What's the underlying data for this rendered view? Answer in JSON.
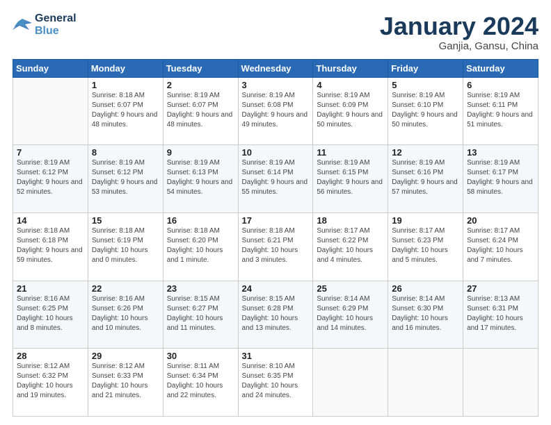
{
  "header": {
    "logo_line1": "General",
    "logo_line2": "Blue",
    "title": "January 2024",
    "subtitle": "Ganjia, Gansu, China"
  },
  "weekdays": [
    "Sunday",
    "Monday",
    "Tuesday",
    "Wednesday",
    "Thursday",
    "Friday",
    "Saturday"
  ],
  "weeks": [
    [
      {
        "day": "",
        "sunrise": "",
        "sunset": "",
        "daylight": ""
      },
      {
        "day": "1",
        "sunrise": "Sunrise: 8:18 AM",
        "sunset": "Sunset: 6:07 PM",
        "daylight": "Daylight: 9 hours and 48 minutes."
      },
      {
        "day": "2",
        "sunrise": "Sunrise: 8:19 AM",
        "sunset": "Sunset: 6:07 PM",
        "daylight": "Daylight: 9 hours and 48 minutes."
      },
      {
        "day": "3",
        "sunrise": "Sunrise: 8:19 AM",
        "sunset": "Sunset: 6:08 PM",
        "daylight": "Daylight: 9 hours and 49 minutes."
      },
      {
        "day": "4",
        "sunrise": "Sunrise: 8:19 AM",
        "sunset": "Sunset: 6:09 PM",
        "daylight": "Daylight: 9 hours and 50 minutes."
      },
      {
        "day": "5",
        "sunrise": "Sunrise: 8:19 AM",
        "sunset": "Sunset: 6:10 PM",
        "daylight": "Daylight: 9 hours and 50 minutes."
      },
      {
        "day": "6",
        "sunrise": "Sunrise: 8:19 AM",
        "sunset": "Sunset: 6:11 PM",
        "daylight": "Daylight: 9 hours and 51 minutes."
      }
    ],
    [
      {
        "day": "7",
        "sunrise": "Sunrise: 8:19 AM",
        "sunset": "Sunset: 6:12 PM",
        "daylight": "Daylight: 9 hours and 52 minutes."
      },
      {
        "day": "8",
        "sunrise": "Sunrise: 8:19 AM",
        "sunset": "Sunset: 6:12 PM",
        "daylight": "Daylight: 9 hours and 53 minutes."
      },
      {
        "day": "9",
        "sunrise": "Sunrise: 8:19 AM",
        "sunset": "Sunset: 6:13 PM",
        "daylight": "Daylight: 9 hours and 54 minutes."
      },
      {
        "day": "10",
        "sunrise": "Sunrise: 8:19 AM",
        "sunset": "Sunset: 6:14 PM",
        "daylight": "Daylight: 9 hours and 55 minutes."
      },
      {
        "day": "11",
        "sunrise": "Sunrise: 8:19 AM",
        "sunset": "Sunset: 6:15 PM",
        "daylight": "Daylight: 9 hours and 56 minutes."
      },
      {
        "day": "12",
        "sunrise": "Sunrise: 8:19 AM",
        "sunset": "Sunset: 6:16 PM",
        "daylight": "Daylight: 9 hours and 57 minutes."
      },
      {
        "day": "13",
        "sunrise": "Sunrise: 8:19 AM",
        "sunset": "Sunset: 6:17 PM",
        "daylight": "Daylight: 9 hours and 58 minutes."
      }
    ],
    [
      {
        "day": "14",
        "sunrise": "Sunrise: 8:18 AM",
        "sunset": "Sunset: 6:18 PM",
        "daylight": "Daylight: 9 hours and 59 minutes."
      },
      {
        "day": "15",
        "sunrise": "Sunrise: 8:18 AM",
        "sunset": "Sunset: 6:19 PM",
        "daylight": "Daylight: 10 hours and 0 minutes."
      },
      {
        "day": "16",
        "sunrise": "Sunrise: 8:18 AM",
        "sunset": "Sunset: 6:20 PM",
        "daylight": "Daylight: 10 hours and 1 minute."
      },
      {
        "day": "17",
        "sunrise": "Sunrise: 8:18 AM",
        "sunset": "Sunset: 6:21 PM",
        "daylight": "Daylight: 10 hours and 3 minutes."
      },
      {
        "day": "18",
        "sunrise": "Sunrise: 8:17 AM",
        "sunset": "Sunset: 6:22 PM",
        "daylight": "Daylight: 10 hours and 4 minutes."
      },
      {
        "day": "19",
        "sunrise": "Sunrise: 8:17 AM",
        "sunset": "Sunset: 6:23 PM",
        "daylight": "Daylight: 10 hours and 5 minutes."
      },
      {
        "day": "20",
        "sunrise": "Sunrise: 8:17 AM",
        "sunset": "Sunset: 6:24 PM",
        "daylight": "Daylight: 10 hours and 7 minutes."
      }
    ],
    [
      {
        "day": "21",
        "sunrise": "Sunrise: 8:16 AM",
        "sunset": "Sunset: 6:25 PM",
        "daylight": "Daylight: 10 hours and 8 minutes."
      },
      {
        "day": "22",
        "sunrise": "Sunrise: 8:16 AM",
        "sunset": "Sunset: 6:26 PM",
        "daylight": "Daylight: 10 hours and 10 minutes."
      },
      {
        "day": "23",
        "sunrise": "Sunrise: 8:15 AM",
        "sunset": "Sunset: 6:27 PM",
        "daylight": "Daylight: 10 hours and 11 minutes."
      },
      {
        "day": "24",
        "sunrise": "Sunrise: 8:15 AM",
        "sunset": "Sunset: 6:28 PM",
        "daylight": "Daylight: 10 hours and 13 minutes."
      },
      {
        "day": "25",
        "sunrise": "Sunrise: 8:14 AM",
        "sunset": "Sunset: 6:29 PM",
        "daylight": "Daylight: 10 hours and 14 minutes."
      },
      {
        "day": "26",
        "sunrise": "Sunrise: 8:14 AM",
        "sunset": "Sunset: 6:30 PM",
        "daylight": "Daylight: 10 hours and 16 minutes."
      },
      {
        "day": "27",
        "sunrise": "Sunrise: 8:13 AM",
        "sunset": "Sunset: 6:31 PM",
        "daylight": "Daylight: 10 hours and 17 minutes."
      }
    ],
    [
      {
        "day": "28",
        "sunrise": "Sunrise: 8:12 AM",
        "sunset": "Sunset: 6:32 PM",
        "daylight": "Daylight: 10 hours and 19 minutes."
      },
      {
        "day": "29",
        "sunrise": "Sunrise: 8:12 AM",
        "sunset": "Sunset: 6:33 PM",
        "daylight": "Daylight: 10 hours and 21 minutes."
      },
      {
        "day": "30",
        "sunrise": "Sunrise: 8:11 AM",
        "sunset": "Sunset: 6:34 PM",
        "daylight": "Daylight: 10 hours and 22 minutes."
      },
      {
        "day": "31",
        "sunrise": "Sunrise: 8:10 AM",
        "sunset": "Sunset: 6:35 PM",
        "daylight": "Daylight: 10 hours and 24 minutes."
      },
      {
        "day": "",
        "sunrise": "",
        "sunset": "",
        "daylight": ""
      },
      {
        "day": "",
        "sunrise": "",
        "sunset": "",
        "daylight": ""
      },
      {
        "day": "",
        "sunrise": "",
        "sunset": "",
        "daylight": ""
      }
    ]
  ]
}
